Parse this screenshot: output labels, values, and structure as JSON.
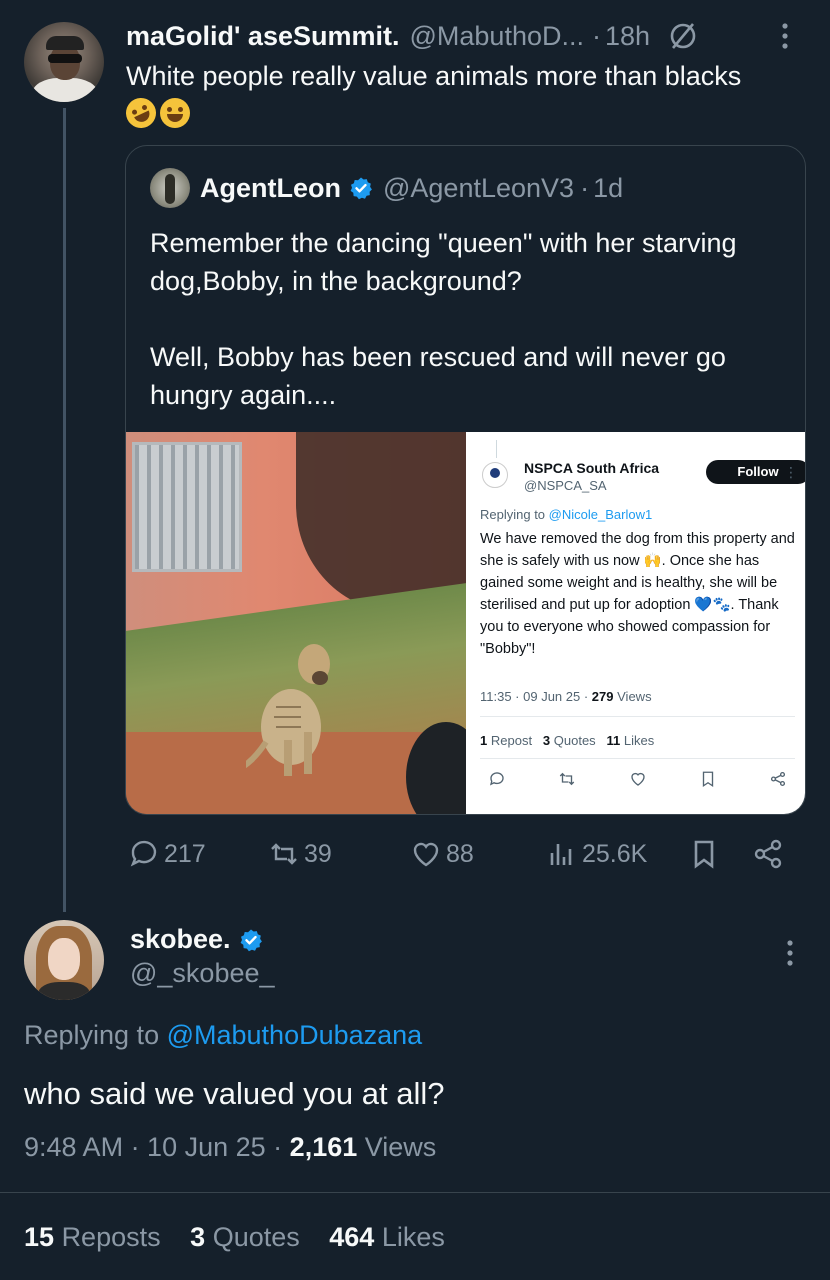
{
  "tweet1": {
    "display_name": "maGolid' aseSummit.",
    "handle": "@MabuthoD...",
    "time": "18h",
    "text": "White people really value animals more than blacks",
    "emojis": [
      "rolling-on-floor-laughing",
      "tears-of-joy"
    ],
    "stats": {
      "replies": "217",
      "reposts": "39",
      "likes": "88",
      "views": "25.6K"
    }
  },
  "quote": {
    "display_name": "AgentLeon",
    "handle": "@AgentLeonV3",
    "time": "1d",
    "paragraph1": "Remember the dancing \"queen\" with her starving dog,Bobby, in the background?",
    "paragraph2": "Well, Bobby has been rescued and will never go hungry again....",
    "card": {
      "name": "NSPCA South Africa",
      "handle": "@NSPCA_SA",
      "follow": "Follow",
      "replying_prefix": "Replying to",
      "replying_to": "@Nicole_Barlow1",
      "body": "We have removed the dog from this property and she is safely with us now 🙌. Once she has gained some weight and is healthy, she will be sterilised and put up for adoption 💙🐾. Thank you to everyone who showed compassion for \"Bobby\"!",
      "time": "11:35 · 09 Jun 25 ·",
      "views_count": "279",
      "views_label": "Views",
      "reposts_count": "1",
      "reposts_label": "Repost",
      "quotes_count": "3",
      "quotes_label": "Quotes",
      "likes_count": "11",
      "likes_label": "Likes"
    }
  },
  "tweet2": {
    "display_name": "skobee.",
    "handle": "@_skobee_",
    "replying_prefix": "Replying to",
    "replying_to": "@MabuthoDubazana",
    "text": "who said we valued you at all?",
    "time": "9:48 AM · 10 Jun 25 ·",
    "views_count": "2,161",
    "views_label": "Views",
    "reposts_count": "15",
    "reposts_label": "Reposts",
    "quotes_count": "3",
    "quotes_label": "Quotes",
    "likes_count": "464",
    "likes_label": "Likes"
  },
  "colors": {
    "background": "#15202b",
    "text": "#f7f9f9",
    "muted": "#8b98a5",
    "link": "#1d9bf0",
    "verified": "#1d9bf0"
  }
}
